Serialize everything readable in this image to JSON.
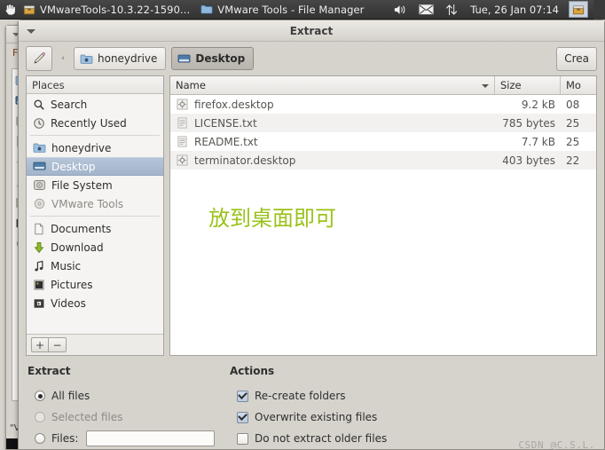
{
  "taskbar": {
    "launcher_icon": "hand-cursor-icon",
    "tasks": [
      {
        "icon": "archive-manager-icon",
        "label": "VMwareTools-10.3.22-1590..."
      },
      {
        "icon": "folder-icon",
        "label": "VMware Tools - File Manager"
      }
    ],
    "tray": {
      "volume_icon": "speaker-volume-icon",
      "mail_icon": "envelope-mail-icon",
      "network_icon": "network-up-down-arrows-icon",
      "clock": "Tue, 26 Jan  07:14",
      "end_icon": "archive-manager-icon"
    }
  },
  "background_window": {
    "menu_label": "F",
    "footer_label": "\"V"
  },
  "window": {
    "title": "Extract",
    "menu_icon": "window-menu-triangle-icon"
  },
  "toolbar": {
    "edit_path_icon": "pencil-edit-icon",
    "crumb_separator": "‹",
    "breadcrumbs": [
      {
        "icon": "home-folder-icon",
        "label": "honeydrive",
        "active": false
      },
      {
        "icon": "desktop-folder-icon",
        "label": "Desktop",
        "active": true
      }
    ],
    "create_folder_label": "Crea"
  },
  "places": {
    "header": "Places",
    "groups": [
      [
        {
          "icon": "search-icon",
          "label": "Search",
          "selected": false,
          "dim": false
        },
        {
          "icon": "recently-used-clock-icon",
          "label": "Recently Used",
          "selected": false,
          "dim": false
        }
      ],
      [
        {
          "icon": "home-folder-icon",
          "label": "honeydrive",
          "selected": false,
          "dim": false
        },
        {
          "icon": "desktop-folder-icon",
          "label": "Desktop",
          "selected": true,
          "dim": false
        },
        {
          "icon": "harddisk-icon",
          "label": "File System",
          "selected": false,
          "dim": false
        },
        {
          "icon": "optical-disc-icon",
          "label": "VMware Tools",
          "selected": false,
          "dim": true
        }
      ],
      [
        {
          "icon": "documents-folder-icon",
          "label": "Documents",
          "selected": false,
          "dim": false
        },
        {
          "icon": "download-arrow-icon",
          "label": "Download",
          "selected": false,
          "dim": false
        },
        {
          "icon": "music-note-icon",
          "label": "Music",
          "selected": false,
          "dim": false
        },
        {
          "icon": "pictures-icon",
          "label": "Pictures",
          "selected": false,
          "dim": false
        },
        {
          "icon": "videos-film-icon",
          "label": "Videos",
          "selected": false,
          "dim": false
        }
      ]
    ],
    "add_label": "+",
    "remove_label": "−"
  },
  "filelist": {
    "columns": {
      "name": "Name",
      "size": "Size",
      "modified": "Mo"
    },
    "sort_column": "Name",
    "rows": [
      {
        "icon": "gear-desktop-file-icon",
        "name": "firefox.desktop",
        "size": "9.2 kB",
        "modified": "08"
      },
      {
        "icon": "text-file-icon",
        "name": "LICENSE.txt",
        "size": "785 bytes",
        "modified": "25"
      },
      {
        "icon": "text-file-icon",
        "name": "README.txt",
        "size": "7.7 kB",
        "modified": "25"
      },
      {
        "icon": "gear-desktop-file-icon",
        "name": "terminator.desktop",
        "size": "403 bytes",
        "modified": "22"
      }
    ],
    "annotation": "放到桌面即可",
    "annotation_color": "#9ac21a"
  },
  "extract_section": {
    "title": "Extract",
    "options": [
      {
        "label": "All files",
        "selected": true,
        "disabled": false
      },
      {
        "label": "Selected files",
        "selected": false,
        "disabled": true
      },
      {
        "label": "Files:",
        "selected": false,
        "disabled": false
      }
    ],
    "files_value": "",
    "files_placeholder": ""
  },
  "actions_section": {
    "title": "Actions",
    "options": [
      {
        "label": "Re-create folders",
        "checked": true
      },
      {
        "label": "Overwrite existing files",
        "checked": true
      },
      {
        "label": "Do not extract older files",
        "checked": false
      }
    ]
  },
  "watermark": "CSDN @C.S.L."
}
